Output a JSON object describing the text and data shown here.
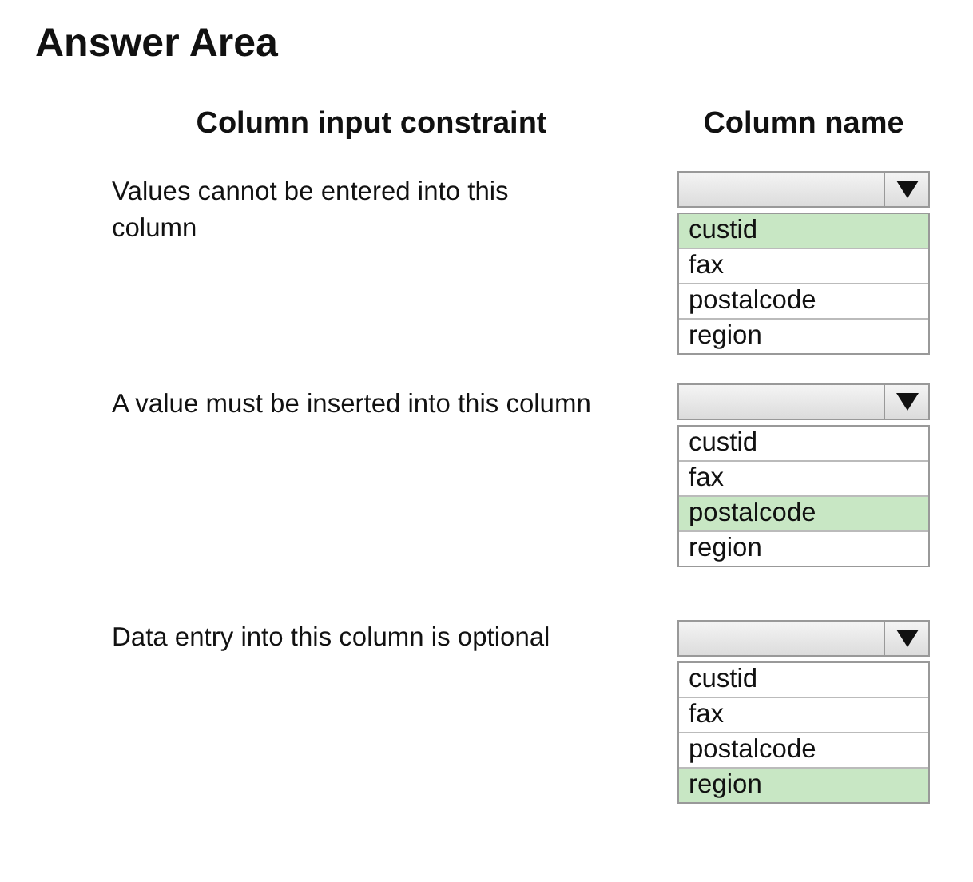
{
  "title": "Answer Area",
  "headers": [
    "Column input constraint",
    "Column name"
  ],
  "rows": [
    {
      "prompt": "Values cannot be entered into this column",
      "options": [
        {
          "label": "custid",
          "selected": true
        },
        {
          "label": "fax",
          "selected": false
        },
        {
          "label": "postalcode",
          "selected": false
        },
        {
          "label": "region",
          "selected": false
        }
      ]
    },
    {
      "prompt": "A value must be inserted into this column",
      "options": [
        {
          "label": "custid",
          "selected": false
        },
        {
          "label": "fax",
          "selected": false
        },
        {
          "label": "postalcode",
          "selected": true
        },
        {
          "label": "region",
          "selected": false
        }
      ]
    },
    {
      "prompt": "Data entry into this column is optional",
      "options": [
        {
          "label": "custid",
          "selected": false
        },
        {
          "label": "fax",
          "selected": false
        },
        {
          "label": "postalcode",
          "selected": false
        },
        {
          "label": "region",
          "selected": true
        }
      ]
    }
  ]
}
